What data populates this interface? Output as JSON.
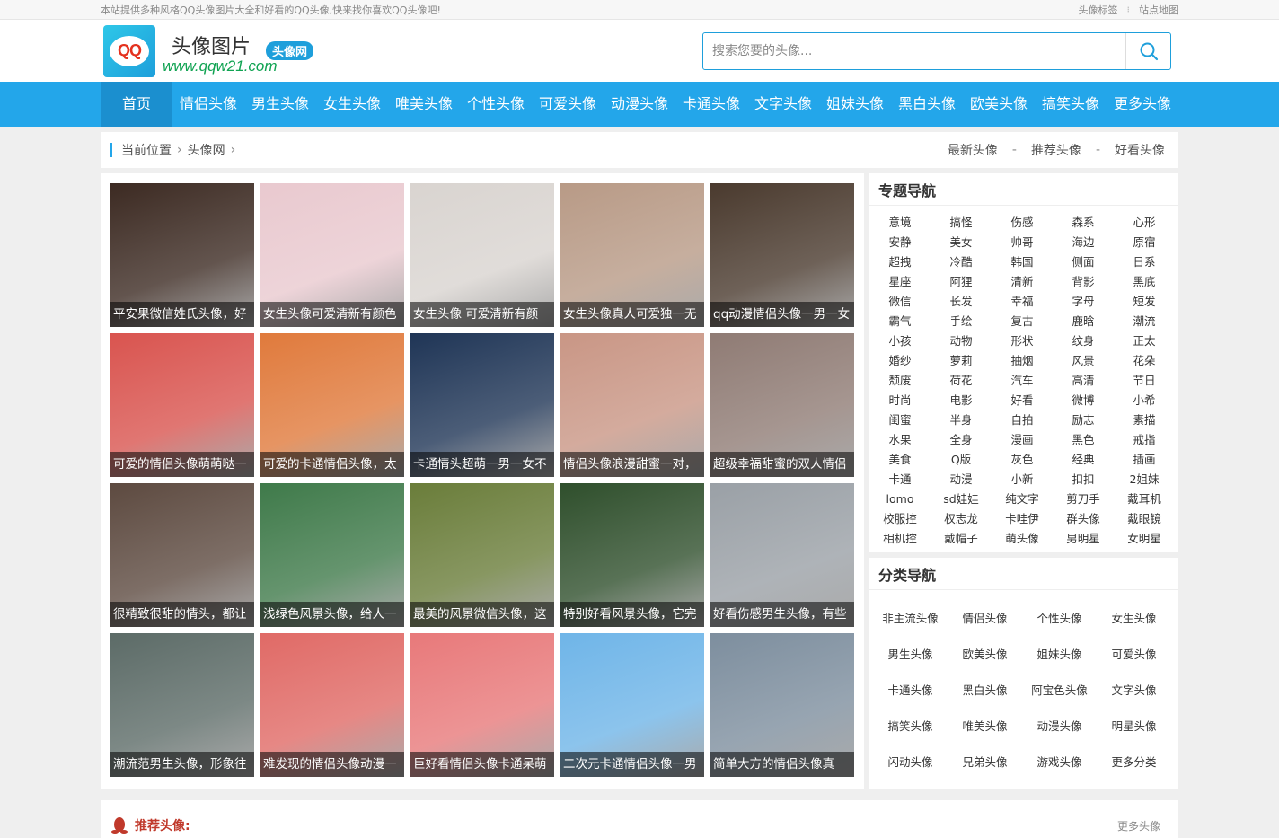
{
  "topbar": {
    "notice": "本站提供多种风格QQ头像图片大全和好看的QQ头像,快来找你喜欢QQ头像吧!",
    "links": [
      "头像标签",
      "站点地图"
    ]
  },
  "logo": {
    "mark": "QQ",
    "title": "头像图片",
    "tag": "头像网",
    "url": "www.qqw21.com"
  },
  "search": {
    "placeholder": "搜索您要的头像..."
  },
  "nav": [
    "首页",
    "情侣头像",
    "男生头像",
    "女生头像",
    "唯美头像",
    "个性头像",
    "可爱头像",
    "动漫头像",
    "卡通头像",
    "文字头像",
    "姐妹头像",
    "黑白头像",
    "欧美头像",
    "搞笑头像",
    "更多头像"
  ],
  "breadcrumb": {
    "items": [
      "当前位置",
      "头像网"
    ],
    "right": [
      "最新头像",
      "推荐头像",
      "好看头像"
    ],
    "sep": "-"
  },
  "gallery": [
    {
      "caption": "平安果微信姓氏头像，好",
      "color": "#3c2a22"
    },
    {
      "caption": "女生头像可爱清新有颜色",
      "color": "#e9c9cf"
    },
    {
      "caption": "女生头像 可爱清新有颜",
      "color": "#d9d4d0"
    },
    {
      "caption": "女生头像真人可爱独一无",
      "color": "#b89a86"
    },
    {
      "caption": "qq动漫情侣头像一男一女",
      "color": "#4a3a2e"
    },
    {
      "caption": "可爱的情侣头像萌萌哒一",
      "color": "#d9544f"
    },
    {
      "caption": "可爱的卡通情侣头像，太",
      "color": "#e07a3c"
    },
    {
      "caption": "卡通情头超萌一男一女不",
      "color": "#1f3556"
    },
    {
      "caption": "情侣头像浪漫甜蜜一对，",
      "color": "#c99685"
    },
    {
      "caption": "超级幸福甜蜜的双人情侣",
      "color": "#8f7b74"
    },
    {
      "caption": "很精致很甜的情头，都让",
      "color": "#5d4a40"
    },
    {
      "caption": "浅绿色风景头像，给人一",
      "color": "#3f7a4a"
    },
    {
      "caption": "最美的风景微信头像，这",
      "color": "#6a7d3a"
    },
    {
      "caption": "特别好看风景头像，它完",
      "color": "#2f4f2c"
    },
    {
      "caption": "好看伤感男生头像，有些",
      "color": "#9aa0a6"
    },
    {
      "caption": "潮流范男生头像，形象往",
      "color": "#5c6b67"
    },
    {
      "caption": "难发现的情侣头像动漫一",
      "color": "#e06a66"
    },
    {
      "caption": "巨好看情侣头像卡通呆萌",
      "color": "#e8797a"
    },
    {
      "caption": "二次元卡通情侣头像一男",
      "color": "#6fb5e8"
    },
    {
      "caption": "简单大方的情侣头像真",
      "color": "#7d8e9e"
    }
  ],
  "topic_nav": {
    "title": "专题导航",
    "items": [
      "意境",
      "搞怪",
      "伤感",
      "森系",
      "心形",
      "安静",
      "美女",
      "帅哥",
      "海边",
      "原宿",
      "超拽",
      "冷酷",
      "韩国",
      "侧面",
      "日系",
      "星座",
      "阿狸",
      "清新",
      "背影",
      "黑底",
      "微信",
      "长发",
      "幸福",
      "字母",
      "短发",
      "霸气",
      "手绘",
      "复古",
      "鹿晗",
      "潮流",
      "小孩",
      "动物",
      "形状",
      "纹身",
      "正太",
      "婚纱",
      "萝莉",
      "抽烟",
      "风景",
      "花朵",
      "颓废",
      "荷花",
      "汽车",
      "高清",
      "节日",
      "时尚",
      "电影",
      "好看",
      "微博",
      "小希",
      "闺蜜",
      "半身",
      "自拍",
      "励志",
      "素描",
      "水果",
      "全身",
      "漫画",
      "黑色",
      "戒指",
      "美食",
      "Q版",
      "灰色",
      "经典",
      "插画",
      "卡通",
      "动漫",
      "小新",
      "扣扣",
      "2姐妹",
      "lomo",
      "sd娃娃",
      "纯文字",
      "剪刀手",
      "戴耳机",
      "校服控",
      "权志龙",
      "卡哇伊",
      "群头像",
      "戴眼镜",
      "相机控",
      "戴帽子",
      "萌头像",
      "男明星",
      "女明星"
    ]
  },
  "category_nav": {
    "title": "分类导航",
    "items": [
      "非主流头像",
      "情侣头像",
      "个性头像",
      "女生头像",
      "男生头像",
      "欧美头像",
      "姐妹头像",
      "可爱头像",
      "卡通头像",
      "黑白头像",
      "阿宝色头像",
      "文字头像",
      "搞笑头像",
      "唯美头像",
      "动漫头像",
      "明星头像",
      "闪动头像",
      "兄弟头像",
      "游戏头像",
      "更多分类"
    ]
  },
  "recommend": {
    "title": "推荐头像:",
    "more": "更多头像"
  },
  "colors": {
    "accent": "#23a6ea",
    "nav_active": "#1b8fcf",
    "logo_url": "#10a352",
    "recommend": "#c0392b"
  }
}
